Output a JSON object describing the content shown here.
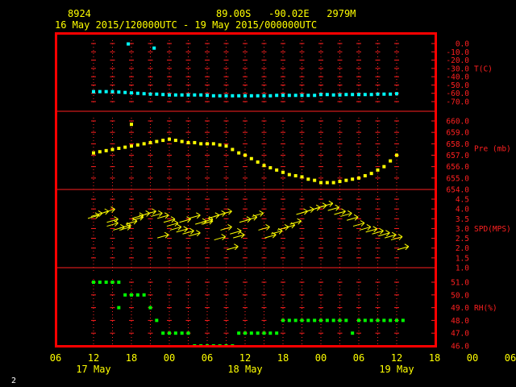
{
  "header": {
    "station": "8924",
    "location": "89.00S   -90.02E   2979M",
    "time_range": "16 May 2015/120000UTC - 19 May 2015/000000UTC"
  },
  "corner_label": "2",
  "colors": {
    "frame": "#ff0000",
    "grid": "#ff2020",
    "temperature": "#00ffff",
    "pressure": "#ffff00",
    "wind": "#ffff00",
    "humidity": "#00ff00",
    "header_text": "#ffff00",
    "axis_label_text": "#ff2020"
  },
  "chart_data": {
    "type": "scatter",
    "x_ticks": [
      "06",
      "12",
      "18",
      "00",
      "06",
      "12",
      "18",
      "00",
      "06",
      "12",
      "18",
      "00",
      "06"
    ],
    "x_day_labels": [
      {
        "label": "17 May",
        "at_hour": 36
      },
      {
        "label": "18 May",
        "at_hour": 60
      },
      {
        "label": "19 May",
        "at_hour": 84
      }
    ],
    "x_range_hours": [
      30,
      90
    ],
    "panels": [
      {
        "name": "temperature",
        "label": "T(C)",
        "unit": "C",
        "ticks": [
          "0.0",
          "-10.0",
          "-20.0",
          "-30.0",
          "-40.0",
          "-50.0",
          "-60.0",
          "-70.0"
        ],
        "ylim": [
          -70,
          0
        ],
        "label_at": -30,
        "x": [
          36,
          37,
          38,
          39,
          40,
          41,
          42,
          43,
          44,
          45,
          46,
          47,
          48,
          49,
          50,
          51,
          52,
          53,
          54,
          55,
          56,
          57,
          58,
          59,
          60,
          61,
          62,
          63,
          64,
          65,
          66,
          67,
          68,
          69,
          70,
          71,
          72,
          73,
          74,
          75,
          76,
          77,
          78,
          79,
          80,
          81,
          82,
          83,
          84,
          41.5,
          45.6
        ],
        "y": [
          -58,
          -58,
          -58,
          -58,
          -58.5,
          -59,
          -59.5,
          -60,
          -60.5,
          -61,
          -61,
          -61.5,
          -62,
          -62,
          -62,
          -62,
          -62,
          -62,
          -62.5,
          -63,
          -63,
          -63,
          -63,
          -63,
          -63,
          -63,
          -63,
          -63,
          -63,
          -62.5,
          -62.5,
          -62.5,
          -62.5,
          -62.5,
          -62.5,
          -62.5,
          -61.5,
          -61.5,
          -62,
          -62,
          -61.5,
          -61.5,
          -61.5,
          -61.5,
          -61.5,
          -61,
          -61,
          -61,
          -60.5,
          -0.5,
          -5.5
        ]
      },
      {
        "name": "pressure",
        "label": "Pre (mb)",
        "unit": "mb",
        "ticks": [
          "660.0",
          "659.0",
          "658.0",
          "657.0",
          "656.0",
          "655.0",
          "654.0"
        ],
        "ylim": [
          654,
          660
        ],
        "label_at": 657.6,
        "x": [
          36,
          37,
          38,
          39,
          40,
          41,
          42,
          43,
          44,
          45,
          46,
          47,
          48,
          49,
          50,
          51,
          52,
          53,
          54,
          55,
          56,
          57,
          58,
          59,
          60,
          61,
          62,
          63,
          64,
          65,
          66,
          67,
          68,
          69,
          70,
          71,
          72,
          73,
          74,
          75,
          76,
          77,
          78,
          79,
          80,
          81,
          82,
          83,
          84,
          42
        ],
        "y": [
          657.2,
          657.3,
          657.4,
          657.5,
          657.6,
          657.7,
          657.8,
          657.9,
          658.0,
          658.1,
          658.2,
          658.3,
          658.4,
          658.3,
          658.2,
          658.1,
          658.1,
          658.0,
          658.0,
          658.0,
          657.9,
          657.8,
          657.5,
          657.2,
          657.0,
          656.7,
          656.4,
          656.1,
          655.9,
          655.7,
          655.5,
          655.3,
          655.2,
          655.1,
          654.9,
          654.8,
          654.6,
          654.6,
          654.6,
          654.7,
          654.8,
          654.9,
          655.0,
          655.2,
          655.4,
          655.7,
          656.0,
          656.5,
          657.0,
          659.7
        ]
      },
      {
        "name": "wind",
        "label": "SPD(MPS)",
        "unit": "MPS",
        "ticks": [
          "4.5",
          "4.0",
          "3.5",
          "3.0",
          "2.5",
          "2.0",
          "1.5",
          "1.0"
        ],
        "ylim": [
          1.0,
          4.5
        ],
        "label_at": 3.0,
        "x": [
          36,
          36.5,
          37.5,
          38.5,
          39,
          40,
          41,
          42,
          43,
          44,
          45,
          46,
          47,
          48,
          49,
          50,
          51,
          52,
          53,
          54,
          55,
          56,
          57,
          58,
          59,
          60,
          61,
          62,
          63,
          64,
          65,
          66,
          67,
          68,
          69,
          70,
          71,
          72,
          73,
          74,
          75,
          76,
          77,
          78,
          79,
          80,
          81,
          82,
          83,
          84,
          85,
          39,
          41,
          43,
          47,
          48.5,
          50.5,
          52,
          54,
          56,
          57,
          58.5
        ],
        "y": [
          3.6,
          3.7,
          3.8,
          3.9,
          3.2,
          3.0,
          3.1,
          3.3,
          3.6,
          3.7,
          3.8,
          3.7,
          3.6,
          3.4,
          3.0,
          2.9,
          2.8,
          2.7,
          3.3,
          3.4,
          3.6,
          3.7,
          3.8,
          2.0,
          2.6,
          3.4,
          3.5,
          3.7,
          3.0,
          2.6,
          2.8,
          3.0,
          3.1,
          3.3,
          3.8,
          3.9,
          4.0,
          4.1,
          4.2,
          4.0,
          3.8,
          3.7,
          3.5,
          3.2,
          3.0,
          2.9,
          2.8,
          2.7,
          2.6,
          2.5,
          2.0,
          3.4,
          3.0,
          3.5,
          2.6,
          3.2,
          3.4,
          3.6,
          3.3,
          2.5,
          3.0,
          2.8
        ],
        "direction": "arrows pointing east"
      },
      {
        "name": "humidity",
        "label": "RH(%)",
        "unit": "%",
        "ticks": [
          "51.0",
          "50.0",
          "49.0",
          "48.0",
          "47.0",
          "46.0"
        ],
        "ylim": [
          46,
          51
        ],
        "label_at": 49,
        "x": [
          36,
          37,
          38,
          39,
          40,
          41,
          42,
          43,
          44,
          45,
          46,
          47,
          48,
          49,
          50,
          51,
          52,
          53,
          54,
          55,
          56,
          57,
          58,
          59,
          60,
          61,
          62,
          63,
          64,
          65,
          66,
          67,
          68,
          69,
          70,
          71,
          72,
          73,
          74,
          75,
          76,
          77,
          78,
          79,
          80,
          81,
          82,
          83,
          84,
          85,
          40
        ],
        "y": [
          51,
          51,
          51,
          51,
          51,
          50,
          50,
          50,
          50,
          49,
          48,
          47,
          47,
          47,
          47,
          47,
          46,
          46,
          46,
          46,
          46,
          46,
          46,
          47,
          47,
          47,
          47,
          47,
          47,
          47,
          48,
          48,
          48,
          48,
          48,
          48,
          48,
          48,
          48,
          48,
          48,
          47,
          48,
          48,
          48,
          48,
          48,
          48,
          48,
          48,
          49
        ]
      }
    ]
  }
}
